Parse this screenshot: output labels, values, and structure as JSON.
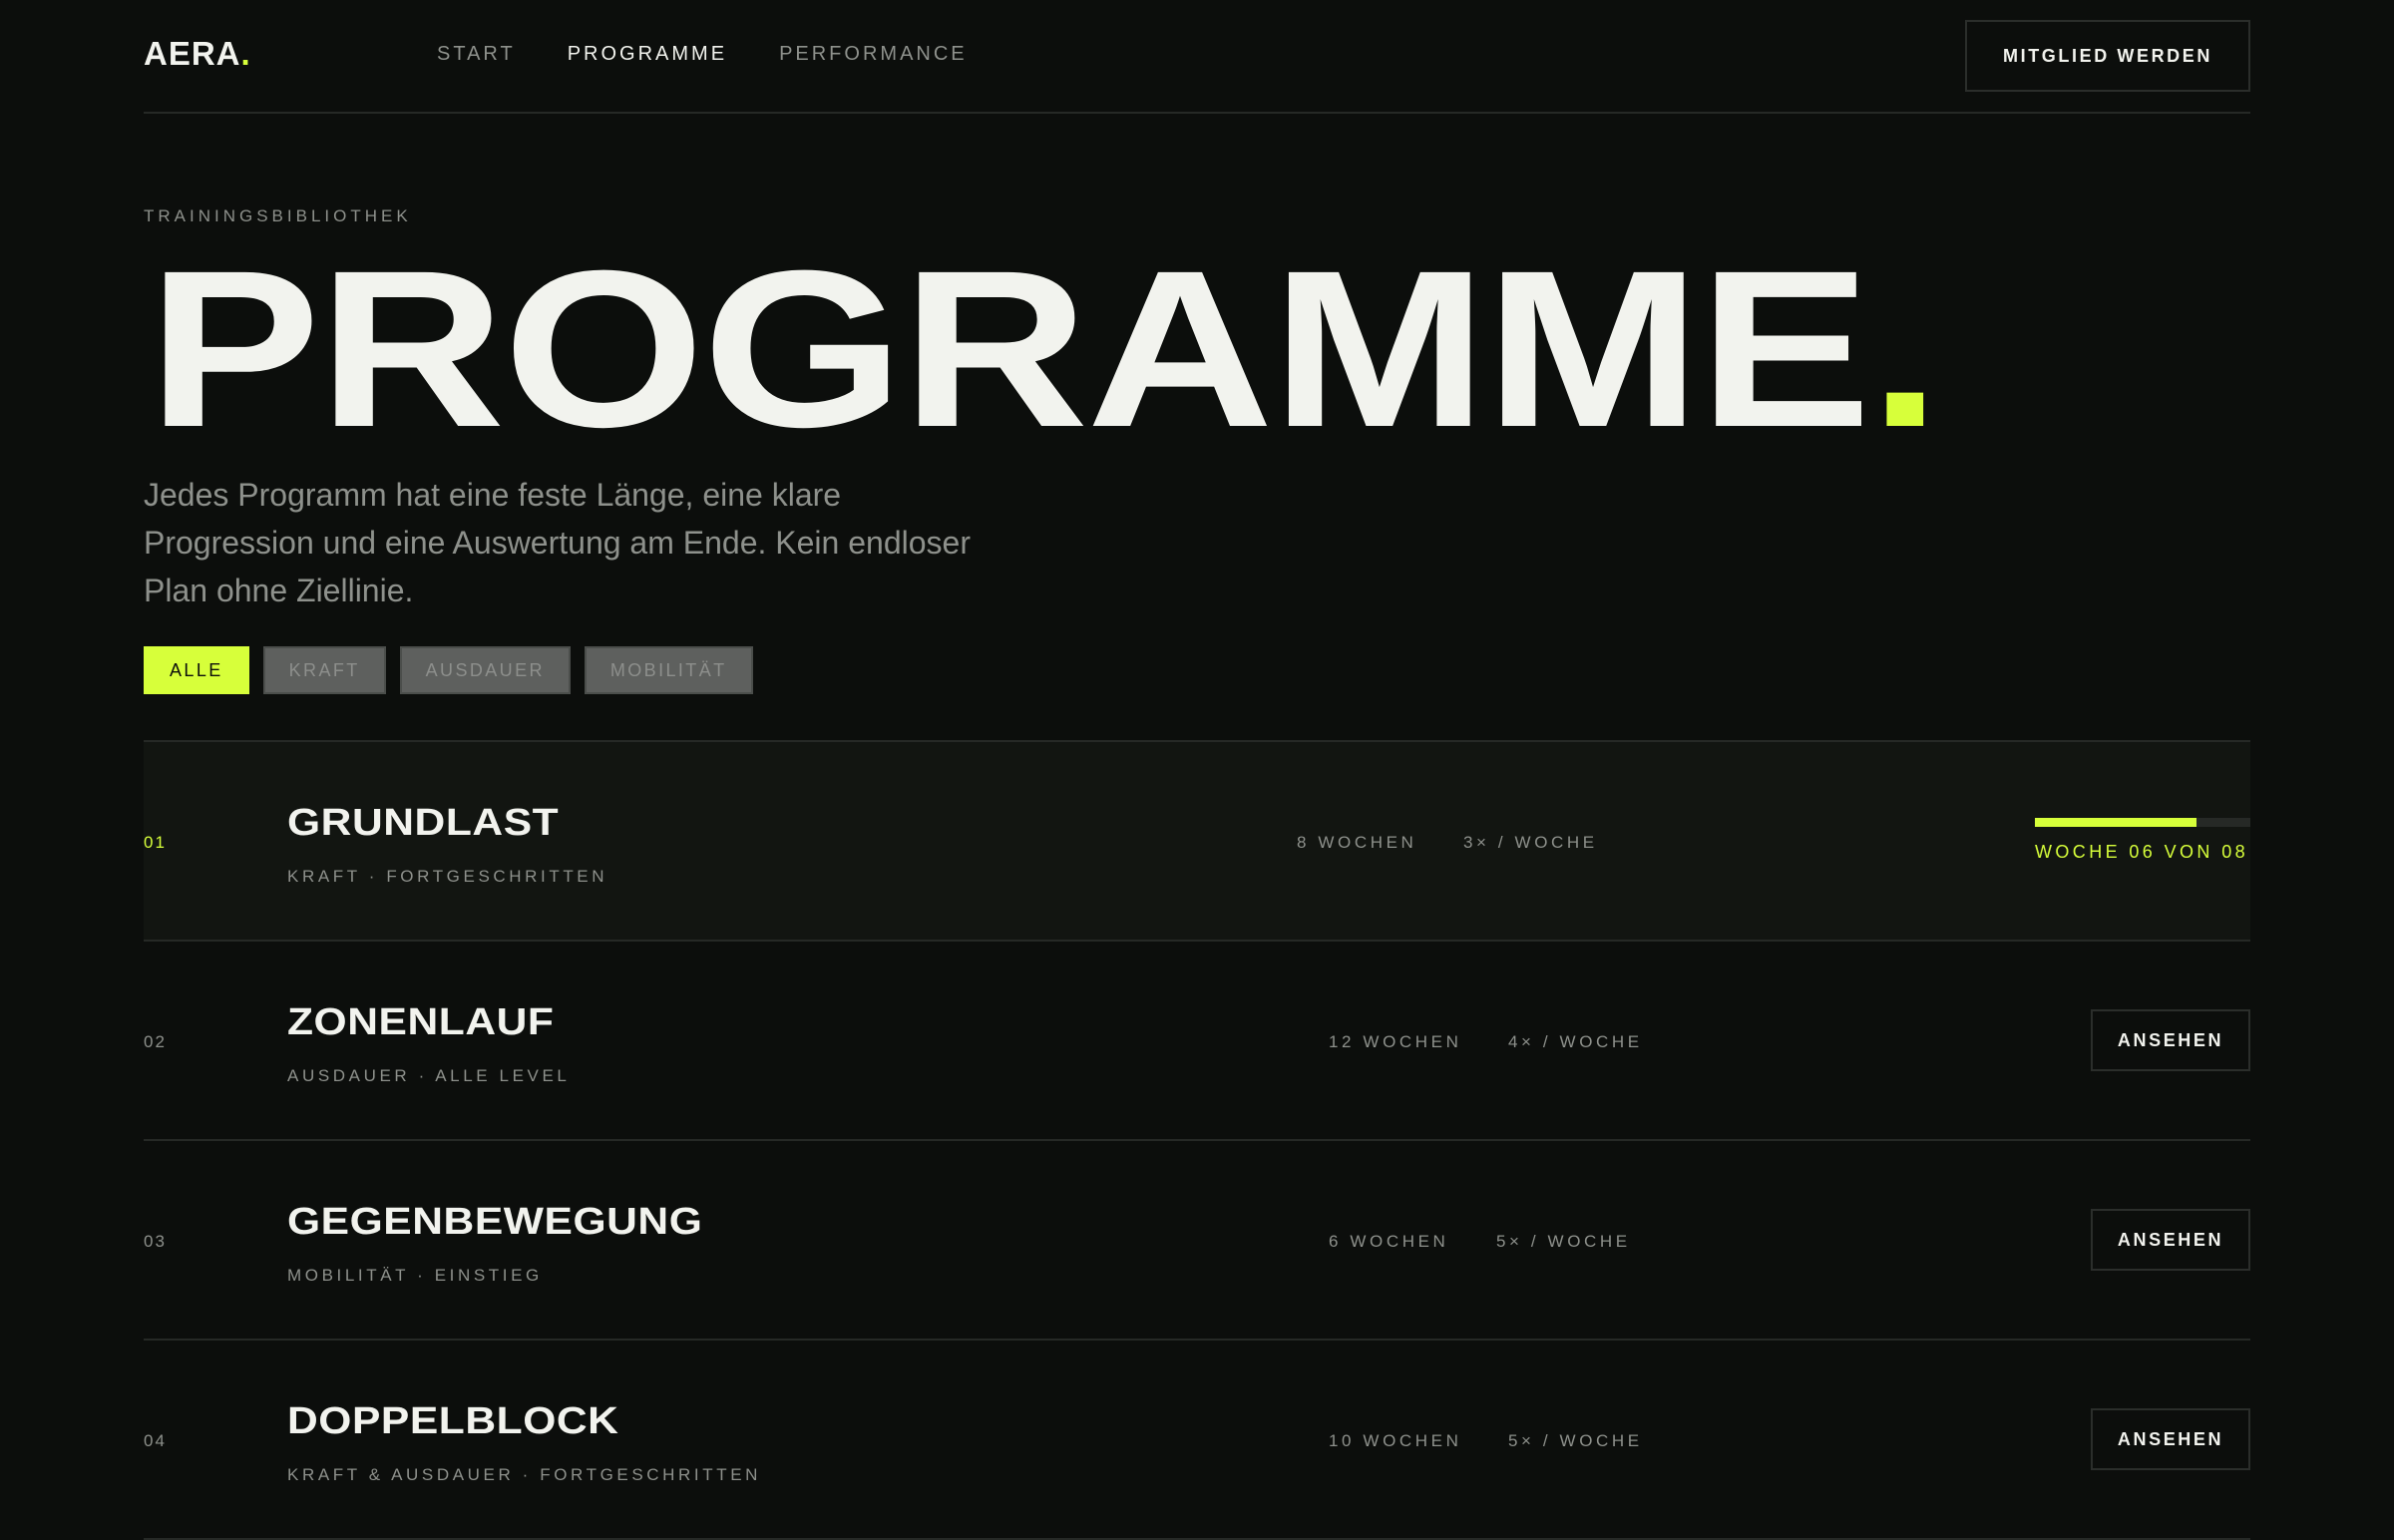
{
  "header": {
    "logo_text": "AERA",
    "logo_dot": ".",
    "nav": [
      {
        "label": "START",
        "active": false
      },
      {
        "label": "PROGRAMME",
        "active": true
      },
      {
        "label": "PERFORMANCE",
        "active": false
      }
    ],
    "cta_label": "MITGLIED WERDEN"
  },
  "hero": {
    "eyebrow": "TRAININGSBIBLIOTHEK",
    "title": "PROGRAMME",
    "title_dot": ".",
    "intro": "Jedes Programm hat eine feste Länge, eine klare Progression und eine Auswertung am Ende. Kein endloser Plan ohne Ziellinie."
  },
  "filters": [
    {
      "label": "ALLE",
      "active": true
    },
    {
      "label": "KRAFT",
      "active": false
    },
    {
      "label": "AUSDAUER",
      "active": false
    },
    {
      "label": "MOBILITÄT",
      "active": false
    }
  ],
  "programs": [
    {
      "number": "01",
      "name": "GRUNDLAST",
      "meta": "KRAFT · FORTGESCHRITTEN",
      "duration": "8 WOCHEN",
      "frequency": "3× / WOCHE",
      "progress_fraction": 0.75,
      "progress_label": "WOCHE 06 VON 08"
    },
    {
      "number": "02",
      "name": "ZONENLAUF",
      "meta": "AUSDAUER · ALLE LEVEL",
      "duration": "12 WOCHEN",
      "frequency": "4× / WOCHE",
      "action_label": "ANSEHEN"
    },
    {
      "number": "03",
      "name": "GEGENBEWEGUNG",
      "meta": "MOBILITÄT · EINSTIEG",
      "duration": "6 WOCHEN",
      "frequency": "5× / WOCHE",
      "action_label": "ANSEHEN"
    },
    {
      "number": "04",
      "name": "DOPPELBLOCK",
      "meta": "KRAFT & AUSDAUER · FORTGESCHRITTEN",
      "duration": "10 WOCHEN",
      "frequency": "5× / WOCHE",
      "action_label": "ANSEHEN"
    }
  ],
  "colors": {
    "accent": "#d7ff3a",
    "background": "#0c0e0c",
    "text": "#f2f3ee",
    "muted": "#8e918c"
  }
}
